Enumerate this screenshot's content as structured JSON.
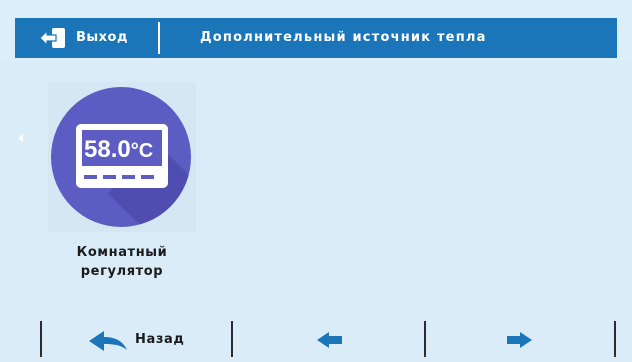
{
  "header": {
    "exit_label": "Выход",
    "title": "Дополнительный источник тепла"
  },
  "tile": {
    "display_value": "58.0",
    "display_unit": "°C",
    "label_line1": "Комнатный",
    "label_line2": "регулятор",
    "icon": "room-thermostat-icon"
  },
  "nav": {
    "back_label": "Назад",
    "back_icon": "back-curved-arrow-icon",
    "prev_icon": "arrow-left-icon",
    "next_icon": "arrow-right-icon"
  },
  "colors": {
    "header_bar": "#1a76b8",
    "background": "#d9ecf8",
    "tile_circle": "#5d5cc2",
    "arrow_blue": "#1a76b8"
  }
}
